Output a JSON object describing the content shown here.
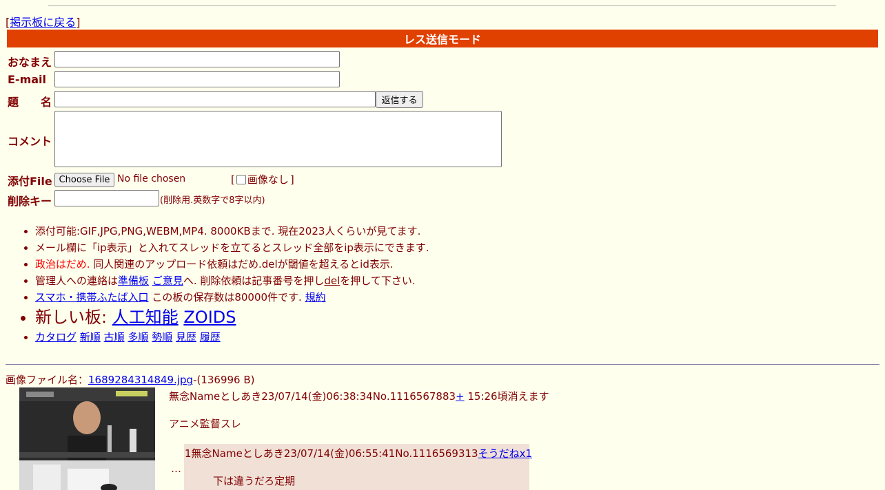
{
  "nav": {
    "back_open": "[",
    "back_label": "掲示板に戻る",
    "back_close": "]"
  },
  "mode_bar": {
    "title": "レス送信モード",
    "color": "#e04000"
  },
  "form": {
    "name_label": "おなまえ",
    "email_label": "E-mail",
    "subject_label": "題　　名",
    "submit_label": "返信する",
    "comment_label": "コメント",
    "file_label": "添付File",
    "choose_file_label": "Choose File",
    "no_file_text": "No file chosen",
    "no_image_open": "[",
    "no_image_label": "画像なし",
    "no_image_close": "]",
    "delete_key_label": "削除キー",
    "delete_key_note": "(削除用.英数字で8字以内)"
  },
  "notes": {
    "line1": "添付可能:GIF,JPG,PNG,WEBM,MP4. 8000KBまで. 現在2023人くらいが見てます.",
    "line2": "メール欄に「ip表示」と入れてスレッドを立てるとスレッド全部をip表示にできます.",
    "line3_red": "政治はだめ.",
    "line3_rest": " 同人関連のアップロード依頼はだめ.delが閾値を超えるとid表示.",
    "line4_pre": "管理人への連絡は",
    "line4_link1": "準備板",
    "line4_link2": "ご意見",
    "line4_mid": "へ. 削除依頼は記事番号を押し",
    "line4_del": "del",
    "line4_post": "を押して下さい.",
    "line5_link": "スマホ・携帯ふたば入口",
    "line5_mid": " この板の保存数は80000件です. ",
    "line5_link2": "規約",
    "line6_pre": "新しい板: ",
    "line6_link1": "人工知能",
    "line6_link2": "ZOIDS",
    "line7_links": [
      "カタログ",
      "新順",
      "古順",
      "多順",
      "勢順",
      "見歴",
      "履歴"
    ]
  },
  "thread": {
    "file_prefix": "画像ファイル名：",
    "file_name": "1689284314849.jpg",
    "file_size": "-(136996 B)",
    "post_header": "無念Nameとしあき23/07/14(金)06:38:34No.1116567883",
    "post_plus": "+",
    "post_expire": " 15:26頃消えます",
    "post_body": "アニメ監督スレ",
    "omitted": "…",
    "reply": {
      "header": "1無念Nameとしあき23/07/14(金)06:55:41No.1116569313",
      "sodane": "そうだねx1",
      "body": "下は違うだろ定期",
      "bg_color": "#f0e0d6"
    }
  }
}
